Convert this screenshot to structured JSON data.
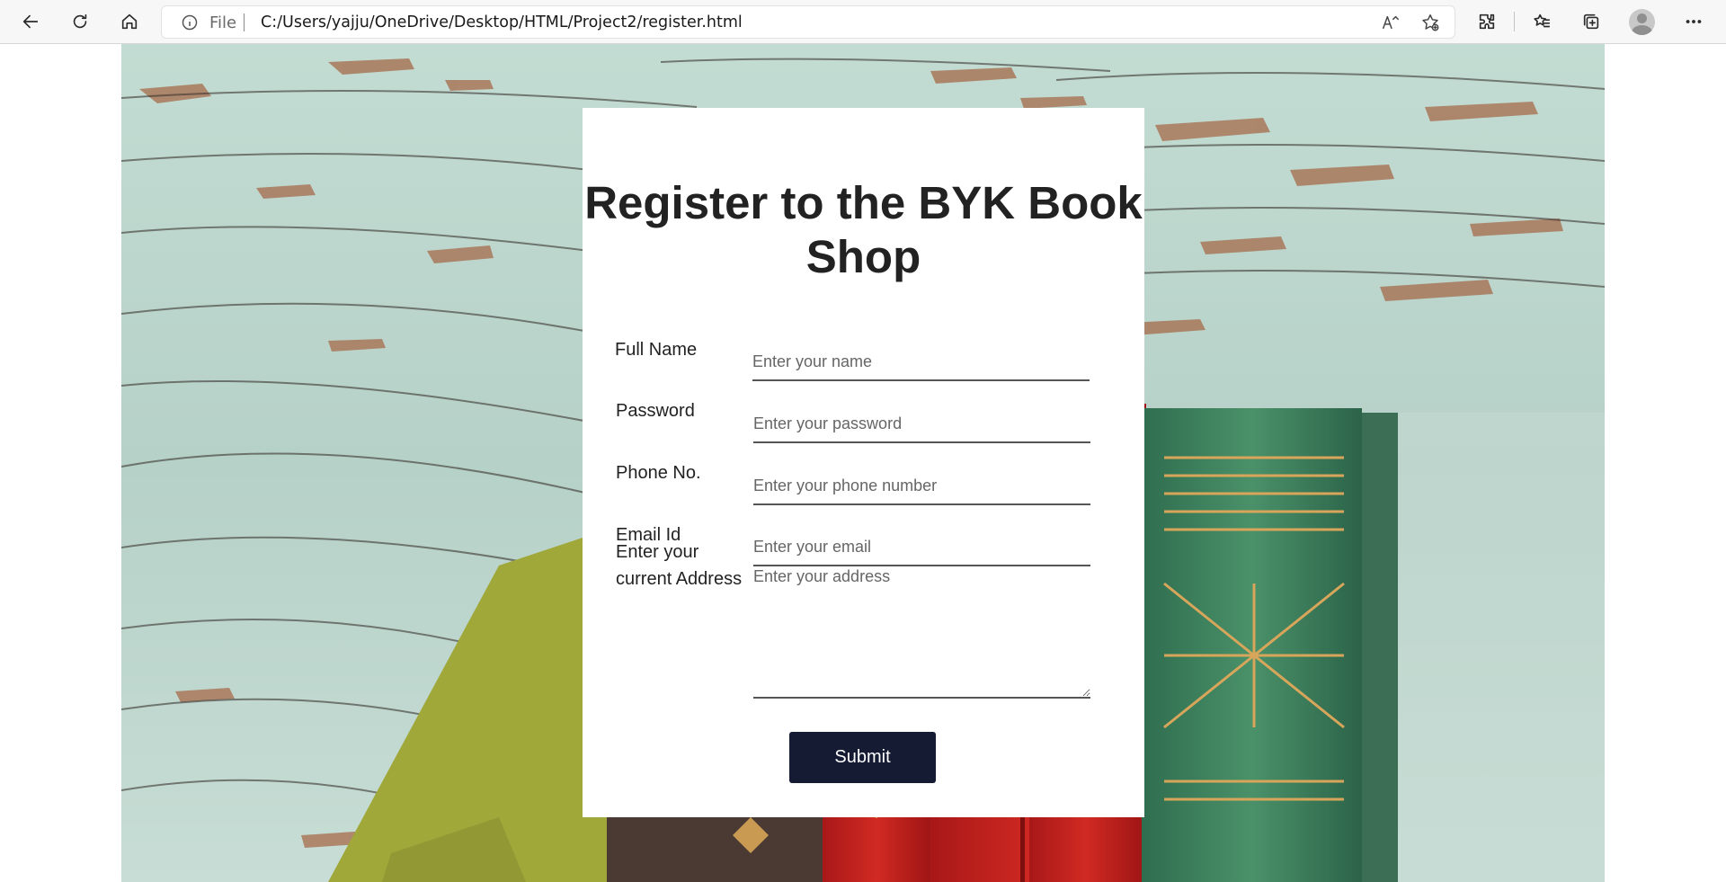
{
  "browser": {
    "address_scheme": "File",
    "url": "C:/Users/yajju/OneDrive/Desktop/HTML/Project2/register.html",
    "icons": {
      "back": "back-arrow-icon",
      "refresh": "refresh-icon",
      "home": "home-icon",
      "info": "info-icon",
      "read_aloud": "read-aloud-icon",
      "add_favorite": "add-favorite-icon",
      "extensions": "extensions-icon",
      "favorites": "favorites-icon",
      "collections": "collections-icon",
      "profile": "profile-avatar-icon",
      "menu": "more-menu-icon"
    }
  },
  "form": {
    "title": "Register to the BYK Book Shop",
    "fields": {
      "name": {
        "label": "Full Name",
        "placeholder": "Enter your name"
      },
      "password": {
        "label": "Password",
        "placeholder": "Enter your password"
      },
      "phone": {
        "label": "Phone No.",
        "placeholder": "Enter your phone number"
      },
      "email": {
        "label": "Email Id",
        "placeholder": "Enter your email"
      },
      "address": {
        "label": "Enter your current Address",
        "placeholder": "Enter your address"
      }
    },
    "submit_label": "Submit"
  },
  "colors": {
    "submit_bg": "#141b33",
    "card_bg": "#ffffff",
    "background_wood": "#b8d4cb"
  }
}
